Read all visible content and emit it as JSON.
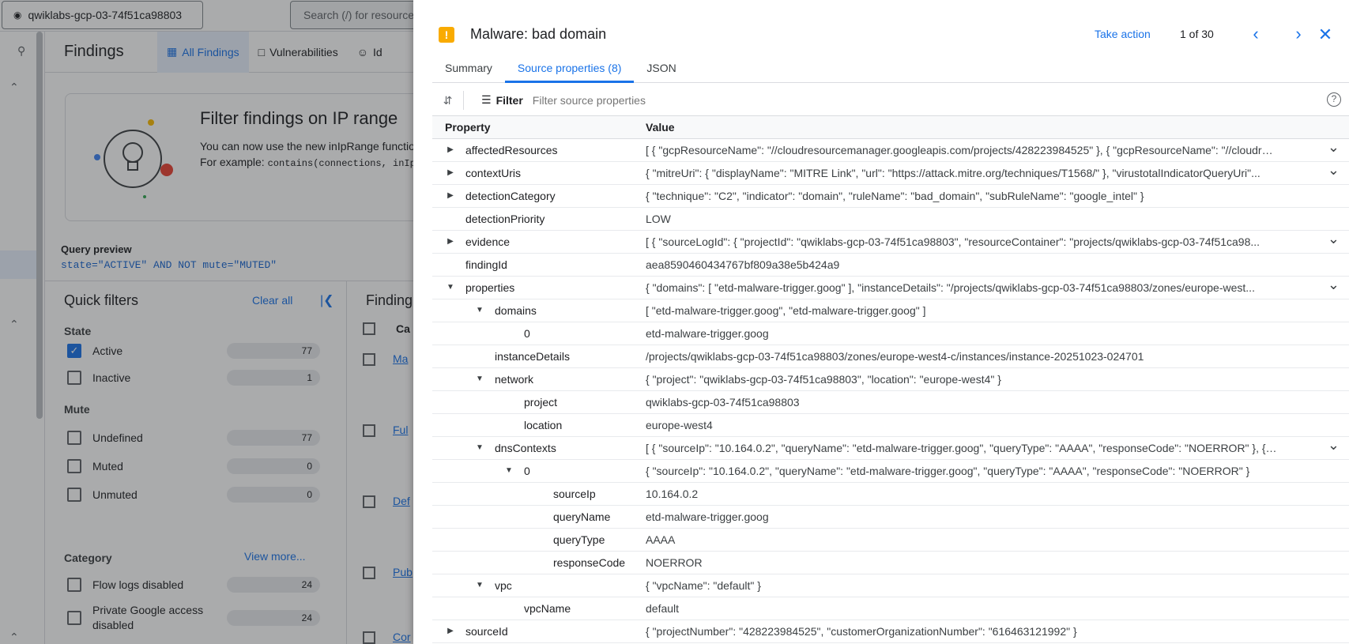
{
  "background": {
    "project_name": "qwiklabs-gcp-03-74f51ca98803",
    "search_placeholder": "Search (/) for resources",
    "page_title": "Findings",
    "tabs": [
      "All Findings",
      "Vulnerabilities",
      "Id"
    ],
    "promo": {
      "title": "Filter findings on IP range",
      "line1": "You can now use the new inIpRange functio",
      "line2_prefix": "For example: ",
      "line2_code": "contains(connections, inIp"
    },
    "query_preview_label": "Query preview",
    "query_preview_text": "state=\"ACTIVE\" AND NOT mute=\"MUTED\"",
    "quick_filters": {
      "title": "Quick filters",
      "clear_all": "Clear all",
      "groups": [
        {
          "name": "State"
        },
        {
          "name": "Mute"
        },
        {
          "name": "Category"
        }
      ],
      "state_items": [
        {
          "label": "Active",
          "count": "77",
          "checked": true
        },
        {
          "label": "Inactive",
          "count": "1",
          "checked": false
        }
      ],
      "mute_items": [
        {
          "label": "Undefined",
          "count": "77"
        },
        {
          "label": "Muted",
          "count": "0"
        },
        {
          "label": "Unmuted",
          "count": "0"
        }
      ],
      "view_more": "View more...",
      "category_items": [
        {
          "label": "Flow logs disabled",
          "count": "24"
        },
        {
          "label": "Private Google access disabled",
          "count": "24"
        }
      ]
    },
    "findings_table_title": "Finding",
    "category_col": "Ca",
    "row_links": [
      "Ma",
      "Ful",
      "Def",
      "Pub",
      "Cor"
    ]
  },
  "drawer": {
    "title": "Malware: bad domain",
    "take_action": "Take action",
    "pager": "1 of 30",
    "tabs": [
      "Summary",
      "Source properties (8)",
      "JSON"
    ],
    "filter_label": "Filter",
    "filter_placeholder": "Filter source properties",
    "columns": [
      "Property",
      "Value"
    ],
    "rows": [
      {
        "indent": 0,
        "toggle": "collapsed",
        "name": "affectedResources",
        "value": "[ { \"gcpResourceName\": \"//cloudresourcemanager.googleapis.com/projects/428223984525\" }, { \"gcpResourceName\": \"//cloudresourcemanager.googleapis.com/...",
        "expand": true
      },
      {
        "indent": 0,
        "toggle": "collapsed",
        "name": "contextUris",
        "value": "{ \"mitreUri\": { \"displayName\": \"MITRE Link\", \"url\": \"https://attack.mitre.org/techniques/T1568/\" }, \"virustotalIndicatorQueryUri\"...",
        "expand": true
      },
      {
        "indent": 0,
        "toggle": "collapsed",
        "name": "detectionCategory",
        "value": "{ \"technique\": \"C2\", \"indicator\": \"domain\", \"ruleName\": \"bad_domain\", \"subRuleName\": \"google_intel\" }",
        "expand": false
      },
      {
        "indent": 0,
        "toggle": "none",
        "name": "detectionPriority",
        "value": "LOW",
        "expand": false
      },
      {
        "indent": 0,
        "toggle": "collapsed",
        "name": "evidence",
        "value": "[ { \"sourceLogId\": { \"projectId\": \"qwiklabs-gcp-03-74f51ca98803\", \"resourceContainer\": \"projects/qwiklabs-gcp-03-74f51ca98...",
        "expand": true
      },
      {
        "indent": 0,
        "toggle": "none",
        "name": "findingId",
        "value": "aea8590460434767bf809a38e5b424a9",
        "expand": false
      },
      {
        "indent": 0,
        "toggle": "expanded",
        "name": "properties",
        "value": "{ \"domains\": [ \"etd-malware-trigger.goog\" ], \"instanceDetails\": \"/projects/qwiklabs-gcp-03-74f51ca98803/zones/europe-west...",
        "expand": true
      },
      {
        "indent": 1,
        "toggle": "expanded",
        "name": "domains",
        "value": "[ \"etd-malware-trigger.goog\", \"etd-malware-trigger.goog\" ]",
        "expand": false
      },
      {
        "indent": 2,
        "toggle": "none",
        "name": "0",
        "value": "etd-malware-trigger.goog",
        "expand": false
      },
      {
        "indent": 1,
        "toggle": "none",
        "name": "instanceDetails",
        "value": "/projects/qwiklabs-gcp-03-74f51ca98803/zones/europe-west4-c/instances/instance-20251023-024701",
        "expand": false
      },
      {
        "indent": 1,
        "toggle": "expanded",
        "name": "network",
        "value": "{ \"project\": \"qwiklabs-gcp-03-74f51ca98803\", \"location\": \"europe-west4\" }",
        "expand": false
      },
      {
        "indent": 2,
        "toggle": "none",
        "name": "project",
        "value": "qwiklabs-gcp-03-74f51ca98803",
        "expand": false
      },
      {
        "indent": 2,
        "toggle": "none",
        "name": "location",
        "value": "europe-west4",
        "expand": false
      },
      {
        "indent": 1,
        "toggle": "expanded",
        "name": "dnsContexts",
        "value": "[ { \"sourceIp\": \"10.164.0.2\", \"queryName\": \"etd-malware-trigger.goog\", \"queryType\": \"AAAA\", \"responseCode\": \"NOERROR\" }, { \"s...",
        "expand": true
      },
      {
        "indent": 2,
        "toggle": "expanded",
        "name": "0",
        "value": "{ \"sourceIp\": \"10.164.0.2\", \"queryName\": \"etd-malware-trigger.goog\", \"queryType\": \"AAAA\", \"responseCode\": \"NOERROR\" }",
        "expand": false
      },
      {
        "indent": 3,
        "toggle": "none",
        "name": "sourceIp",
        "value": "10.164.0.2",
        "expand": false
      },
      {
        "indent": 3,
        "toggle": "none",
        "name": "queryName",
        "value": "etd-malware-trigger.goog",
        "expand": false
      },
      {
        "indent": 3,
        "toggle": "none",
        "name": "queryType",
        "value": "AAAA",
        "expand": false
      },
      {
        "indent": 3,
        "toggle": "none",
        "name": "responseCode",
        "value": "NOERROR",
        "expand": false
      },
      {
        "indent": 1,
        "toggle": "expanded",
        "name": "vpc",
        "value": "{ \"vpcName\": \"default\" }",
        "expand": false
      },
      {
        "indent": 2,
        "toggle": "none",
        "name": "vpcName",
        "value": "default",
        "expand": false
      },
      {
        "indent": 0,
        "toggle": "collapsed",
        "name": "sourceId",
        "value": "{ \"projectNumber\": \"428223984525\", \"customerOrganizationNumber\": \"616463121992\" }",
        "expand": false
      }
    ]
  },
  "colors": {
    "accent": "#1a73e8",
    "warning": "#f9ab00"
  }
}
